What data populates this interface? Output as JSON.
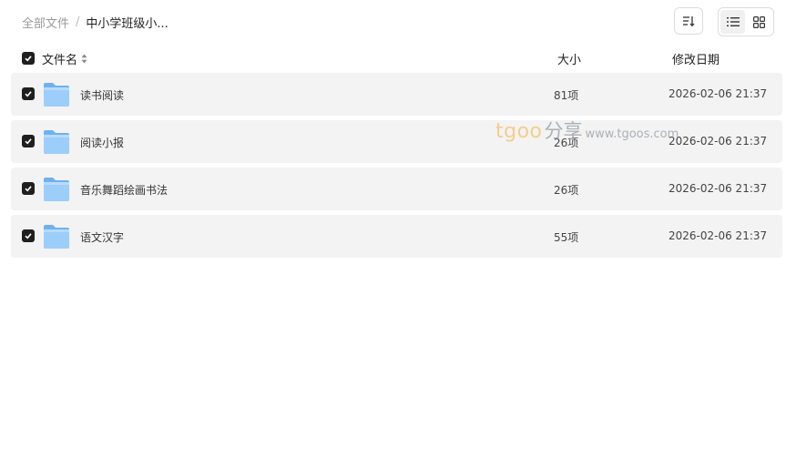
{
  "breadcrumb": {
    "root": "全部文件",
    "separator": "/",
    "current": "中小学班级小..."
  },
  "toolbar": {
    "sort_icon": "sort-icon",
    "view_list_icon": "list-view-icon",
    "view_grid_icon": "grid-view-icon"
  },
  "table": {
    "headers": {
      "name": "文件名",
      "size": "大小",
      "date": "修改日期"
    },
    "rows": [
      {
        "name": "读书阅读",
        "size": "81项",
        "date": "2026-02-06 21:37",
        "checked": true
      },
      {
        "name": "阅读小报",
        "size": "26项",
        "date": "2026-02-06 21:37",
        "checked": true
      },
      {
        "name": "音乐舞蹈绘画书法",
        "size": "26项",
        "date": "2026-02-06 21:37",
        "checked": true
      },
      {
        "name": "语文汉字",
        "size": "55项",
        "date": "2026-02-06 21:37",
        "checked": true
      }
    ]
  },
  "watermark": {
    "brand": "tgoo",
    "share": "分享",
    "url": "www.tgoos.com"
  },
  "colors": {
    "row_bg": "#f3f3f3",
    "checkbox": "#1f1f1f",
    "folder_top": "#a9d3fb",
    "folder_body": "#8cc2f7"
  }
}
